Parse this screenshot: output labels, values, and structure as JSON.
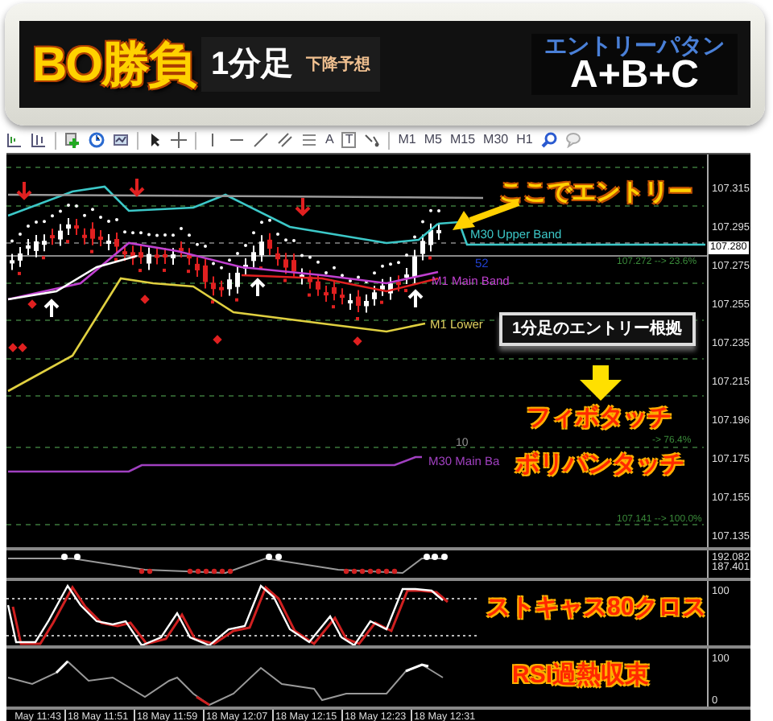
{
  "banner": {
    "title": "BO勝負",
    "timeframe": "1分足",
    "forecast": "下降予想",
    "pattern_label": "エントリーパタン",
    "pattern": "A+B+C"
  },
  "toolbar": {
    "text_tool": "A",
    "label_tool": "T",
    "timeframes": [
      "M1",
      "M5",
      "M15",
      "M30",
      "H1"
    ]
  },
  "chart": {
    "price_ticks": [
      "107.315",
      "107.295",
      "107.275",
      "107.255",
      "107.235",
      "107.215",
      "107.196",
      "107.175",
      "107.155",
      "107.135"
    ],
    "current_price": "107.280",
    "indicator_labels": [
      {
        "text": "M30 Upper Band",
        "color": "#3cc8c8"
      },
      {
        "text": "52",
        "color": "#2040d0"
      },
      {
        "text": "M1 Main Band",
        "color": "#c040d0"
      },
      {
        "text": "M1 Lower",
        "color": "#e0d060"
      },
      {
        "text": "10",
        "color": "#909090"
      },
      {
        "text": "M30 Main Ba",
        "color": "#a040c0"
      }
    ],
    "fib_labels": [
      "107.272 --> 23.6%",
      "-> 76.4%",
      "107.141 --> 100.0%"
    ],
    "sub_panel_ticks": [
      "192.082",
      "187.401"
    ],
    "stochastic_ticks": [
      "100"
    ],
    "rsi_ticks": [
      "100",
      "0"
    ],
    "time_labels": [
      "May 11:43",
      "18 May 11:51",
      "18 May 11:59",
      "18 May 12:07",
      "18 May 12:15",
      "18 May 12:23",
      "18 May 12:31"
    ]
  },
  "annotations": [
    {
      "kind": "caption",
      "text": "ここでエントリー"
    },
    {
      "kind": "boxed",
      "text": "1分足のエントリー根拠"
    },
    {
      "kind": "reason",
      "text": "フィボタッチ"
    },
    {
      "kind": "reason",
      "text": "ボリバンタッチ"
    },
    {
      "kind": "reason",
      "text": "ストキャス80クロス"
    },
    {
      "kind": "reason",
      "text": "RSI過熱収束"
    }
  ]
}
